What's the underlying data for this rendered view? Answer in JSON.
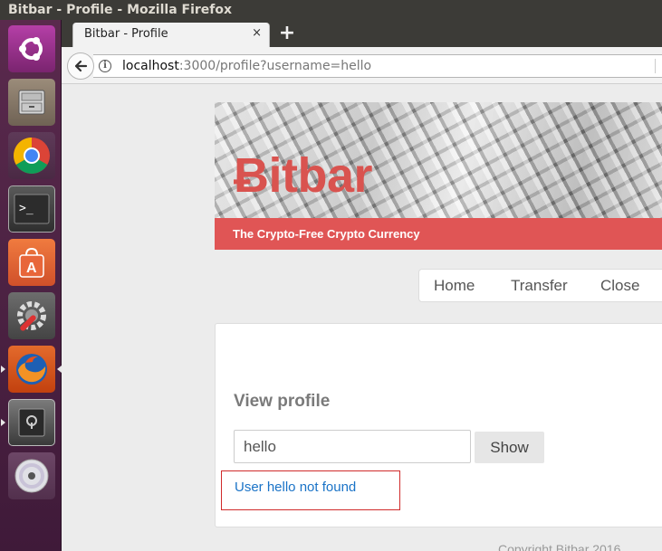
{
  "window": {
    "title": "Bitbar - Profile - Mozilla Firefox"
  },
  "launcher": {
    "items": [
      {
        "name": "ubuntu-dash-icon"
      },
      {
        "name": "files-icon"
      },
      {
        "name": "chrome-icon"
      },
      {
        "name": "terminal-icon"
      },
      {
        "name": "software-center-icon"
      },
      {
        "name": "system-settings-icon"
      },
      {
        "name": "firefox-icon"
      },
      {
        "name": "safe-icon"
      },
      {
        "name": "disc-icon"
      }
    ]
  },
  "browser": {
    "tab": {
      "title": "Bitbar - Profile",
      "close": "×"
    },
    "new_tab": "+",
    "url": {
      "host": "localhost",
      "path": ":3000/profile?username=hello"
    }
  },
  "site": {
    "brand": "Ƀitbar",
    "tagline": "The Crypto-Free Crypto Currency",
    "brand_color": "#d9534f",
    "banner_color": "#e05555",
    "menu": [
      "Home",
      "Transfer",
      "Close"
    ]
  },
  "profile": {
    "title": "View profile",
    "input_value": "hello",
    "show_label": "Show",
    "error": "User hello not found",
    "link_color": "#1a73c7"
  },
  "footer": {
    "text": "Copyright Bitbar 2016"
  }
}
